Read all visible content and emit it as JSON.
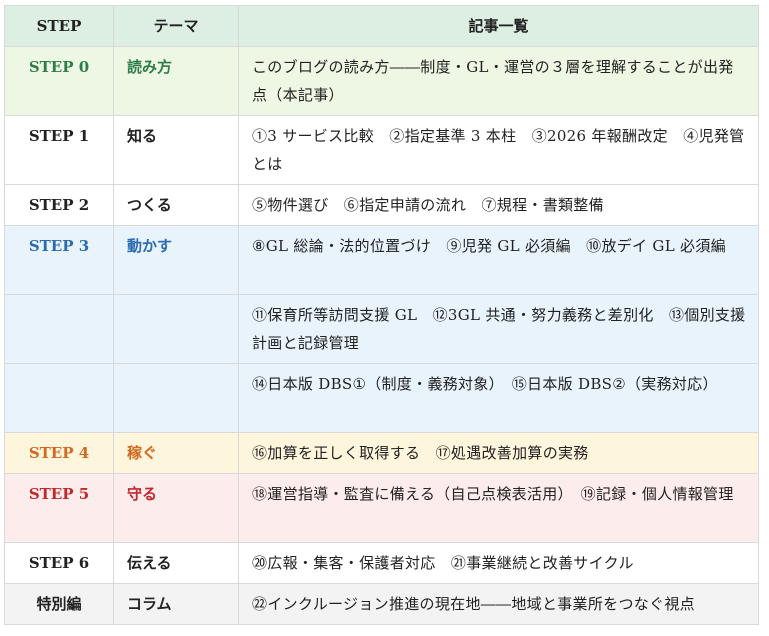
{
  "table": {
    "headers": [
      "STEP",
      "テーマ",
      "記事一覧"
    ],
    "header_bg": "#dcefe2",
    "rows": [
      {
        "step": "STEP 0",
        "theme": "読み方",
        "articles": "このブログの読み方――制度・GL・運営の３層を理解することが出発点（本記事）",
        "bg": "#eef7e3",
        "accent": "#2e7d4a",
        "lines": 2
      },
      {
        "step": "STEP 1",
        "theme": "知る",
        "articles": "①3 サービス比較　②指定基準 3 本柱　③2026 年報酬改定　④児発管とは",
        "bg": "#ffffff",
        "accent": "#222222",
        "lines": 2
      },
      {
        "step": "STEP 2",
        "theme": "つくる",
        "articles": "⑤物件選び　⑥指定申請の流れ　⑦規程・書類整備",
        "bg": "#ffffff",
        "accent": "#222222",
        "lines": 1
      },
      {
        "step": "STEP 3",
        "theme": "動かす",
        "articles": "⑧GL 総論・法的位置づけ　⑨児発 GL 必須編　⑩放デイ GL 必須編",
        "bg": "#e8f3fc",
        "accent": "#2b6cb0",
        "lines": 2
      },
      {
        "step": "",
        "theme": "",
        "articles": "⑪保育所等訪問支援 GL　⑫3GL 共通・努力義務と差別化　⑬個別支援計画と記録管理",
        "bg": "#e8f3fc",
        "accent": "#2b6cb0",
        "lines": 2
      },
      {
        "step": "",
        "theme": "",
        "articles": "⑭日本版 DBS①（制度・義務対象）　⑮日本版 DBS②（実務対応）",
        "bg": "#e8f3fc",
        "accent": "#2b6cb0",
        "lines": 2
      },
      {
        "step": "STEP 4",
        "theme": "稼ぐ",
        "articles": "⑯加算を正しく取得する　⑰処遇改善加算の実務",
        "bg": "#fdf5dc",
        "accent": "#d2691e",
        "lines": 1
      },
      {
        "step": "STEP 5",
        "theme": "守る",
        "articles": "⑱運営指導・監査に備える（自己点検表活用）　⑲記録・個人情報管理",
        "bg": "#fdecec",
        "accent": "#c0282d",
        "lines": 2
      },
      {
        "step": "STEP 6",
        "theme": "伝える",
        "articles": "⑳広報・集客・保護者対応　㉑事業継続と改善サイクル",
        "bg": "#ffffff",
        "accent": "#222222",
        "lines": 1
      },
      {
        "step": "特別編",
        "theme": "コラム",
        "articles": "㉒インクルージョン推進の現在地――地域と事業所をつなぐ視点",
        "bg": "#f3f3f3",
        "accent": "#222222",
        "lines": 1
      }
    ]
  }
}
